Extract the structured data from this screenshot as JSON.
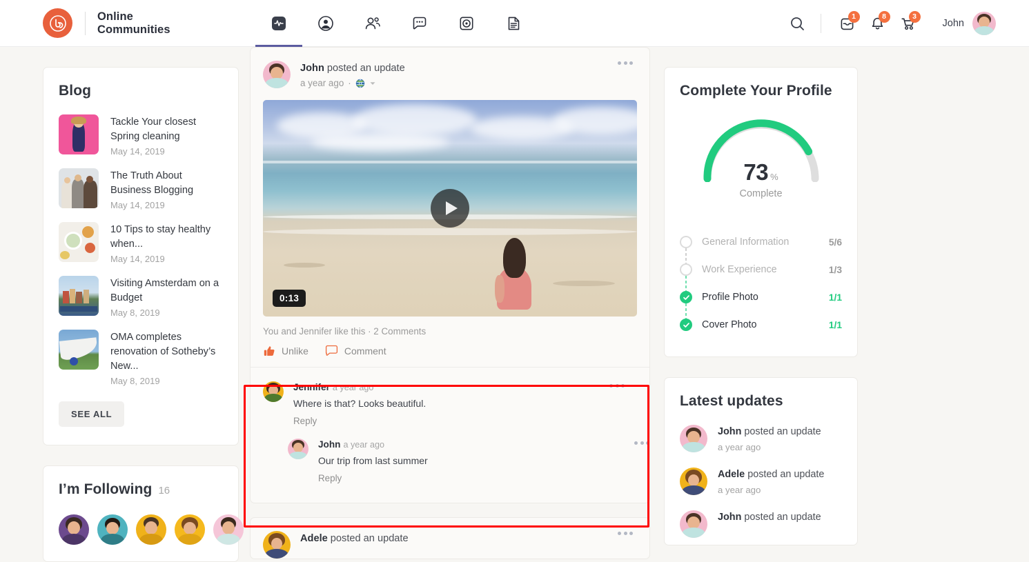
{
  "header": {
    "brand_line1": "Online",
    "brand_line2": "Communities",
    "logo_icon": "buddyboss-logo-icon",
    "nav": [
      {
        "label": "Activity",
        "icon": "activity-pulse-icon",
        "active": true
      },
      {
        "label": "Profile",
        "icon": "user-circle-icon",
        "active": false
      },
      {
        "label": "Members",
        "icon": "people-group-icon",
        "active": false
      },
      {
        "label": "Messages",
        "icon": "chat-bubble-icon",
        "active": false
      },
      {
        "label": "Media",
        "icon": "photo-circle-icon",
        "active": false
      },
      {
        "label": "Documents",
        "icon": "document-icon",
        "active": false
      }
    ],
    "search_icon": "search-icon",
    "inbox_icon": "inbox-icon",
    "inbox_badge": "1",
    "notifications_icon": "bell-icon",
    "notifications_badge": "8",
    "cart_icon": "cart-icon",
    "cart_badge": "3",
    "user_name": "John",
    "user_avatar": "john-avatar",
    "badge_color": "#f4703f",
    "active_tab_color": "#5b5ba0",
    "brand_color": "#e8603c"
  },
  "sidebar_left": {
    "blog": {
      "title": "Blog",
      "items": [
        {
          "title": "Tackle Your closest Spring cleaning",
          "date": "May 14, 2019",
          "thumb": "fashion-pink-thumb"
        },
        {
          "title": "The Truth About Business Blogging",
          "date": "May 14, 2019",
          "thumb": "business-people-thumb"
        },
        {
          "title": "10 Tips to stay healthy when...",
          "date": "May 14, 2019",
          "thumb": "healthy-food-thumb"
        },
        {
          "title": "Visiting Amsterdam on a Budget",
          "date": "May 8, 2019",
          "thumb": "amsterdam-canal-thumb"
        },
        {
          "title": "OMA completes renovation of Sotheby’s New...",
          "date": "May 8, 2019",
          "thumb": "architecture-thumb"
        }
      ],
      "see_all_label": "SEE ALL"
    },
    "following": {
      "title": "I’m Following",
      "count": "16",
      "avatars": [
        "avatar-purple",
        "avatar-teal",
        "avatar-yellow",
        "avatar-amber",
        "avatar-pink"
      ]
    }
  },
  "feed": {
    "post": {
      "author": "John",
      "action": " posted an update",
      "time": "a year ago",
      "privacy_icon": "globe-icon",
      "privacy_caret_icon": "caret-down-icon",
      "options_icon": "more-options-icon",
      "video": {
        "alt": "woman sitting on beach looking at ocean",
        "duration": "0:13",
        "play_icon": "play-icon"
      },
      "likes_text": "You and Jennifer like this · 2 Comments",
      "actions": [
        {
          "label": "Unlike",
          "icon": "thumbs-up-icon"
        },
        {
          "label": "Comment",
          "icon": "comment-bubble-icon"
        }
      ],
      "comments": [
        {
          "author": "Jennifer",
          "time": "a year ago",
          "text": "Where is that? Looks beautiful.",
          "reply_label": "Reply",
          "avatar": "jennifer-avatar",
          "options_icon": "more-options-icon"
        },
        {
          "author": "John",
          "time": "a year ago",
          "text": "Our trip from last summer",
          "reply_label": "Reply",
          "avatar": "john-avatar",
          "options_icon": "more-options-icon"
        }
      ]
    },
    "post_next": {
      "author": "Adele",
      "action": " posted an update",
      "options_icon": "more-options-icon",
      "avatar": "adele-avatar"
    }
  },
  "sidebar_right": {
    "profile": {
      "title": "Complete Your Profile",
      "percent": "73",
      "percent_symbol": "%",
      "complete_label": "Complete",
      "progress_color": "#21cb7f",
      "track_color": "#dedede",
      "steps": [
        {
          "label": "General Information",
          "value": "5/6",
          "done": false
        },
        {
          "label": "Work Experience",
          "value": "1/3",
          "done": false
        },
        {
          "label": "Profile Photo",
          "value": "1/1",
          "done": true
        },
        {
          "label": "Cover Photo",
          "value": "1/1",
          "done": true
        }
      ]
    },
    "updates": {
      "title": "Latest updates",
      "items": [
        {
          "author": "John",
          "action": " posted an update",
          "time": "a year ago",
          "avatar": "john-avatar"
        },
        {
          "author": "Adele",
          "action": " posted an update",
          "time": "a year ago",
          "avatar": "adele-avatar"
        },
        {
          "author": "John",
          "action": " posted an update",
          "time": "",
          "avatar": "john-avatar"
        }
      ]
    }
  },
  "annotation": {
    "color": "#ff0000",
    "target": "comments-section"
  }
}
